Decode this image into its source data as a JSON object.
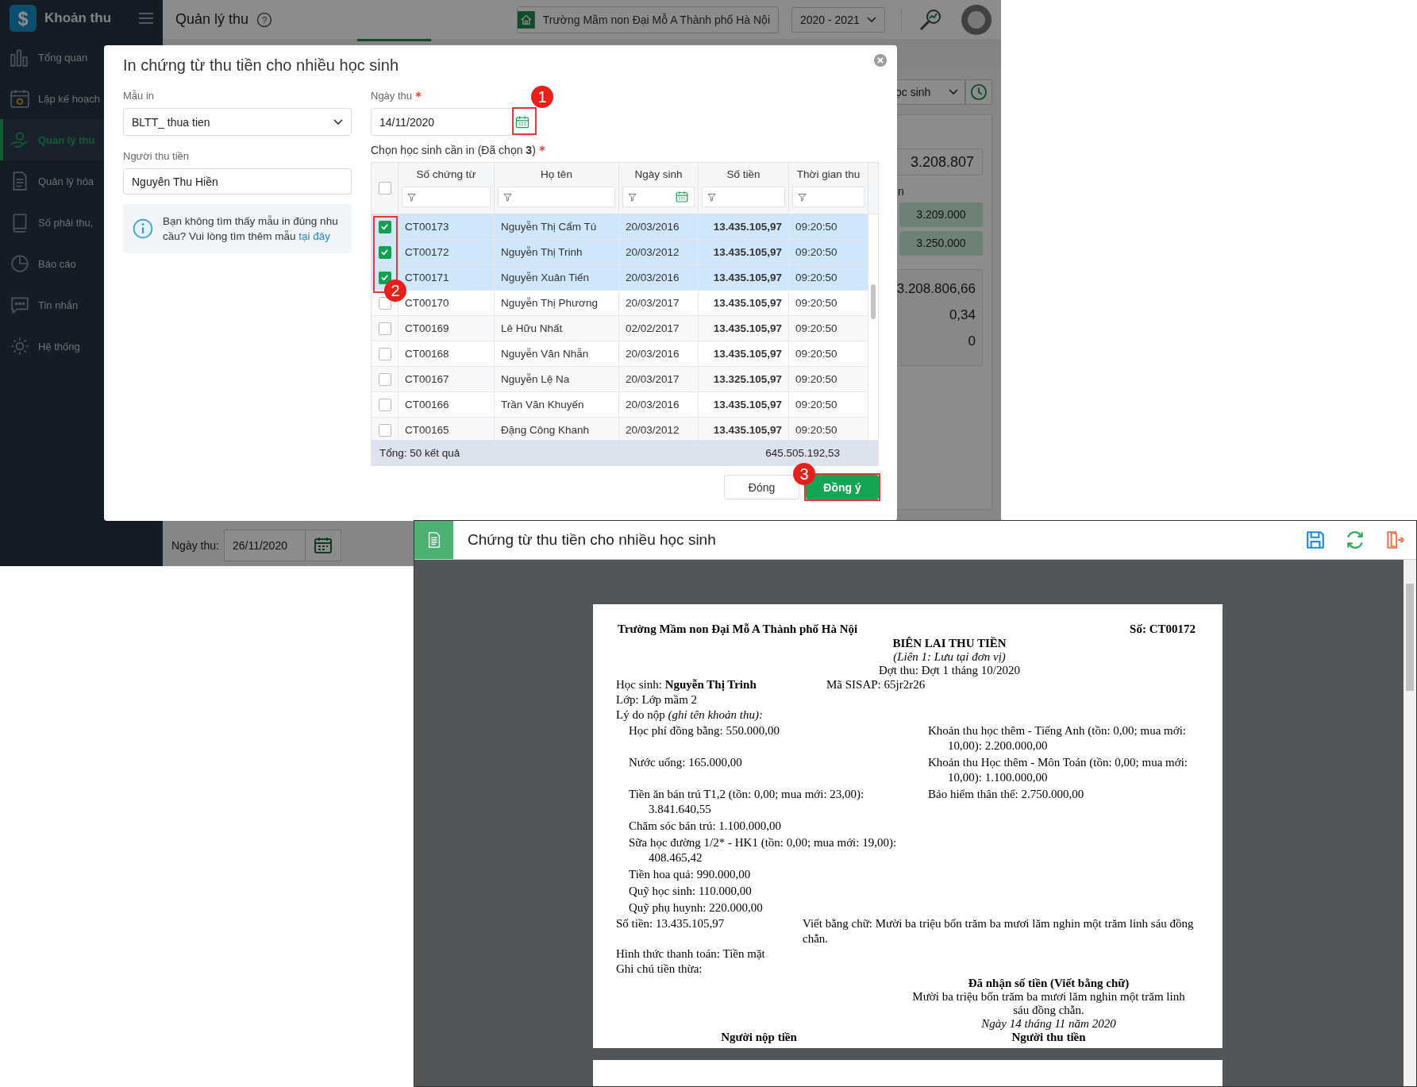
{
  "app": {
    "logo_glyph": "$",
    "brand": "Khoản thu",
    "sidebar": {
      "items": [
        {
          "label": "Tổng quan",
          "selected": false
        },
        {
          "label": "Lập kế hoạch",
          "selected": false
        },
        {
          "label": "Quản lý thu",
          "selected": true
        },
        {
          "label": "Quản lý hóa",
          "selected": false
        },
        {
          "label": "Số phải thu,",
          "selected": false
        },
        {
          "label": "Báo cáo",
          "selected": false
        },
        {
          "label": "Tin nhắn",
          "selected": false
        },
        {
          "label": "Hệ thống",
          "selected": false
        }
      ]
    },
    "header": {
      "title": "Quản lý thu",
      "help_glyph": "?",
      "school": "Trường Mầm non Đại Mỗ A Thành phố Hà Nội",
      "school_year": "2020 - 2021"
    },
    "panel": {
      "dropdown": "ọc sinh",
      "total": "3.208.807",
      "label": "n",
      "amounts": [
        "3.209.000",
        "3.250.000"
      ],
      "summary": [
        "3.208.806,66",
        "0,34",
        "0"
      ]
    },
    "bottom_bar": {
      "date_label": "Ngày thu:",
      "date": "26/11/2020"
    }
  },
  "dialog": {
    "title": "In chứng từ thu tiền cho nhiều học sinh",
    "template": {
      "label": "Mẫu in",
      "value": "BLTT_ thua tien"
    },
    "collector": {
      "label": "Người thu tiền",
      "value": "Nguyên Thu Hiền"
    },
    "info": "Bạn không tìm thấy mẫu in đúng nhu cầu? Vui lòng tìm thêm mẫu",
    "info_link": "tại đây",
    "date": {
      "label": "Ngày thu",
      "required": true,
      "value": "14/11/2020",
      "step": "1"
    },
    "students_label": "Chọn học sinh cần in (Đã chọn **3**)",
    "students_required": true,
    "table": {
      "step": "2",
      "select_all_checked": false,
      "columns": [
        "Số chứng từ",
        "Họ tên",
        "Ngày sinh",
        "Số tiền",
        "Thời gian thu"
      ],
      "rows": [
        {
          "checked": true,
          "cells": [
            "CT00173",
            "Nguyễn Thị Cẩm Tú",
            "20/03/2016",
            "13.435.105,97",
            "09:20:50"
          ]
        },
        {
          "checked": true,
          "cells": [
            "CT00172",
            "Nguyễn Thị Trinh",
            "20/03/2012",
            "13.435.105,97",
            "09:20:50"
          ]
        },
        {
          "checked": true,
          "cells": [
            "CT00171",
            "Nguyễn Xuân Tiến",
            "20/03/2016",
            "13.435.105,97",
            "09:20:50"
          ]
        },
        {
          "checked": false,
          "cells": [
            "CT00170",
            "Nguyễn Thị Phương",
            "20/03/2017",
            "13.435.105,97",
            "09:20:50"
          ]
        },
        {
          "checked": false,
          "cells": [
            "CT00169",
            "Lê Hữu Nhất",
            "02/02/2017",
            "13.435.105,97",
            "09:20:50"
          ]
        },
        {
          "checked": false,
          "cells": [
            "CT00168",
            "Nguyễn Văn Nhẫn",
            "20/03/2016",
            "13.435.105,97",
            "09:20:50"
          ]
        },
        {
          "checked": false,
          "cells": [
            "CT00167",
            "Nguyễn Lệ Na",
            "20/03/2017",
            "13.325.105,97",
            "09:20:50"
          ]
        },
        {
          "checked": false,
          "cells": [
            "CT00166",
            "Trần Văn Khuyến",
            "20/03/2016",
            "13.435.105,97",
            "09:20:50"
          ]
        },
        {
          "checked": false,
          "cells": [
            "CT00165",
            "Đặng Công Khanh",
            "20/03/2012",
            "13.435.105,97",
            "09:20:50"
          ]
        }
      ],
      "total_label": "Tổng: 50 kết quả",
      "total_amount": "645.505.192,53"
    },
    "buttons": [
      {
        "label": "Đóng",
        "kind": "secondary"
      },
      {
        "label": "Đồng ý",
        "kind": "primary",
        "step": "3"
      }
    ]
  },
  "preview": {
    "title": "Chứng từ thu tiền cho nhiều học sinh",
    "receipt": {
      "school": "Trường Mầm non Đại Mỗ A Thành phố Hà Nội",
      "number": "Số: CT00172",
      "title": "BIÊN LAI THU TIỀN",
      "copy": "(Liên 1: Lưu tại đơn vị)",
      "batch": "Đợt thu: Đợt 1 tháng 10/2020",
      "student": "Học sinh: **Nguyễn Thị Trinh**",
      "sisap": "Mã SISAP: 65jr2r26",
      "class": "Lớp: Lớp mầm 2",
      "reason": "Lý do nộp *(ghi tên khoản thu):*",
      "fee_rows": [
        {
          "left": "Học phí đồng bằng: 550.000,00",
          "right": "Khoản thu học thêm - Tiếng Anh (tồn: 0,00; mua mới: 10,00): 2.200.000,00"
        },
        {
          "left": "Nước uống: 165.000,00",
          "right": "Khoản thu Học thêm - Môn Toán (tồn: 0,00; mua mới: 10,00): 1.100.000,00"
        },
        {
          "left": "Tiền ăn bán trú T1,2 (tồn: 0,00; mua mới: 23,00): 3.841.640,55",
          "right": "Bảo hiểm thân thể: 2.750.000,00"
        },
        {
          "left": "Chăm sóc bán trú: 1.100.000,00"
        },
        {
          "left": "Sữa học đường 1/2* - HK1 (tồn: 0,00; mua mới: 19,00): 408.465,42"
        },
        {
          "left": "Tiền hoa quả: 990.000,00"
        },
        {
          "left": "Quỹ học sinh: 110.000,00"
        },
        {
          "left": "Quỹ phụ huynh: 220.000,00"
        }
      ],
      "amount": "Số tiền: 13.435.105,97",
      "amount_words": "Viết bằng chữ: Mười ba triệu bốn trăm ba mươi lăm nghin một trăm linh sáu đồng chẵn.",
      "payment": "Hình thức thanh toán: Tiền mặt",
      "note": "Ghi chú tiền thừa:",
      "received_title": "Đã nhận số tiền (Viết bằng chữ)",
      "received_words": "Mười ba triệu bốn trăm ba mươi lăm nghin một trăm linh sáu đồng chẵn.",
      "date": "Ngày 14 tháng 11 năm 2020",
      "signers": [
        "Người nộp tiền",
        "Người thu tiền"
      ]
    }
  }
}
